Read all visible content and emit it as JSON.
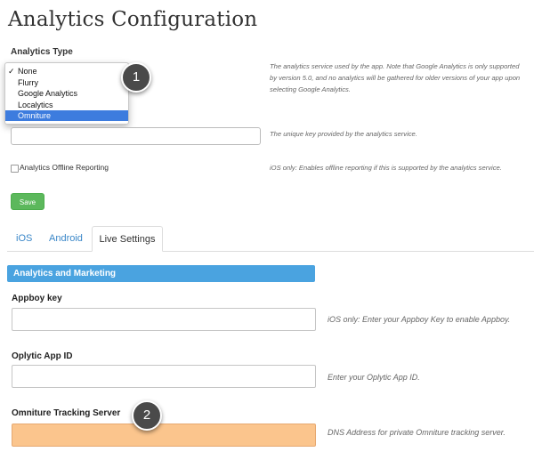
{
  "page": {
    "title": "Analytics Configuration"
  },
  "analytics_type": {
    "label": "Analytics Type",
    "options": [
      {
        "label": "None",
        "checked": true
      },
      {
        "label": "Flurry"
      },
      {
        "label": "Google Analytics"
      },
      {
        "label": "Localytics"
      },
      {
        "label": "Omniture",
        "highlighted": true
      }
    ],
    "help": "The analytics service used by the app. Note that Google Analytics is only supported by version 5.0, and no analytics will be gathered for older versions of your app upon selecting Google Analytics."
  },
  "analytics_key": {
    "value": "",
    "help": "The unique key provided by the analytics service."
  },
  "offline_reporting": {
    "label": "Analytics Offline Reporting",
    "checked": false,
    "help": "iOS only: Enables offline reporting if this is supported by the analytics service."
  },
  "save_label": "Save",
  "tabs": [
    {
      "label": "iOS"
    },
    {
      "label": "Android"
    },
    {
      "label": "Live Settings",
      "active": true
    }
  ],
  "section": {
    "title": "Analytics and Marketing"
  },
  "fields": {
    "appboy": {
      "label": "Appboy key",
      "value": "",
      "help": "iOS only: Enter your Appboy Key to enable Appboy."
    },
    "oplytic": {
      "label": "Oplytic App ID",
      "value": "",
      "help": "Enter your Oplytic App ID."
    },
    "omniture": {
      "label": "Omniture Tracking Server",
      "value": "",
      "help": "DNS Address for private Omniture tracking server."
    }
  },
  "callouts": [
    "1",
    "2"
  ],
  "colors": {
    "accent": "#4aa3e0",
    "save": "#5cb85c",
    "selected": "#3d7cde",
    "highlight": "#fbc58d"
  }
}
